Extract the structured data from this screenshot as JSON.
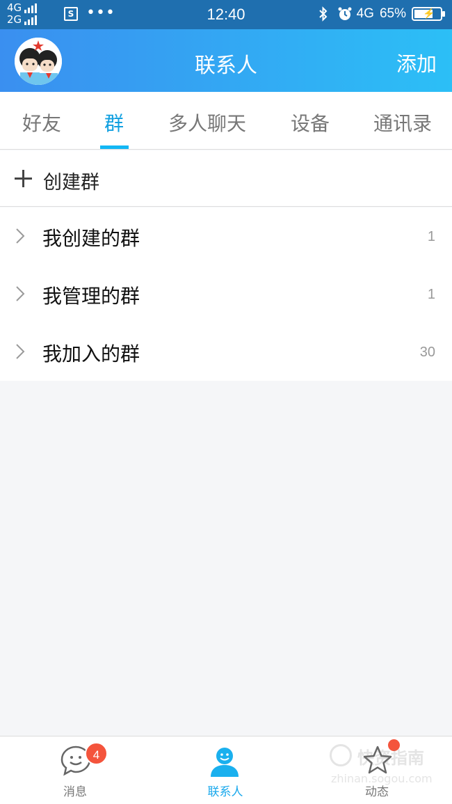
{
  "status_bar": {
    "network_top": "4G",
    "network_bottom": "2G",
    "screenshot_glyph": "S",
    "more_dots": "•••",
    "time": "12:40",
    "network_right": "4G",
    "battery": "65%",
    "icons": [
      "bluetooth-icon",
      "alarm-icon",
      "battery-icon"
    ]
  },
  "header": {
    "title": "联系人",
    "add_label": "添加",
    "accent_start": "#3a8ff0",
    "accent_end": "#2cbff6"
  },
  "tabs": [
    {
      "label": "好友",
      "active": false
    },
    {
      "label": "群",
      "active": true
    },
    {
      "label": "多人聊天",
      "active": false
    },
    {
      "label": "设备",
      "active": false
    },
    {
      "label": "通讯录",
      "active": false
    }
  ],
  "create_group": {
    "label": "创建群",
    "icon": "plus-icon"
  },
  "groups": [
    {
      "label": "我创建的群",
      "count": "1",
      "icon": "chevron-right-icon"
    },
    {
      "label": "我管理的群",
      "count": "1",
      "icon": "chevron-right-icon"
    },
    {
      "label": "我加入的群",
      "count": "30",
      "icon": "chevron-right-icon"
    }
  ],
  "bottom_nav": [
    {
      "label": "消息",
      "icon": "chat-icon",
      "badge": "4",
      "active": false
    },
    {
      "label": "联系人",
      "icon": "contacts-icon",
      "active": true
    },
    {
      "label": "动态",
      "icon": "star-icon",
      "dot": true,
      "active": false
    }
  ],
  "watermark": {
    "text": "快资指南",
    "url": "zhinan.sogou.com"
  },
  "colors": {
    "active_tab": "#12a0e0",
    "badge": "#f4543c",
    "status_bar": "#1f6faf"
  }
}
